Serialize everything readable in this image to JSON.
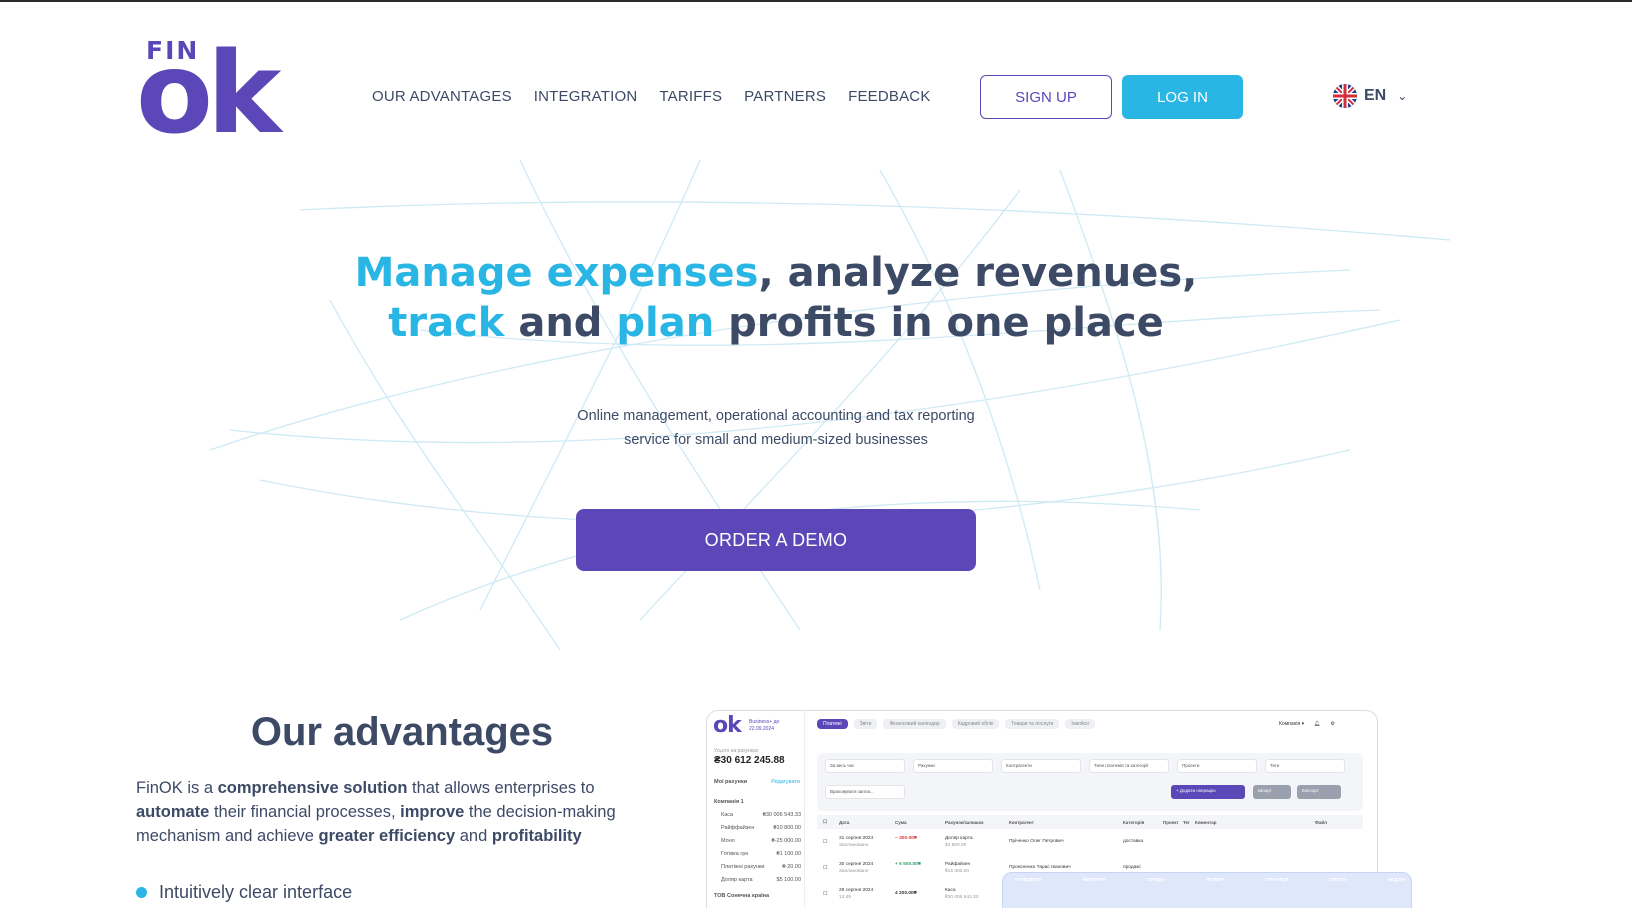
{
  "header": {
    "logo_top": "FIN",
    "logo_bottom": "ok",
    "nav": [
      "OUR ADVANTAGES",
      "INTEGRATION",
      "TARIFFS",
      "PARTNERS",
      "FEEDBACK"
    ],
    "signup_label": "SIGN UP",
    "login_label": "LOG IN",
    "language": "EN",
    "language_icon": "uk-flag-icon"
  },
  "hero": {
    "title_parts": [
      {
        "text": "Manage expenses",
        "accent": true
      },
      {
        "text": ", analyze revenues,",
        "accent": false
      },
      {
        "text": "track",
        "accent": true
      },
      {
        "text": " and ",
        "accent": false
      },
      {
        "text": "plan",
        "accent": true
      },
      {
        "text": " profits in one place",
        "accent": false
      }
    ],
    "subtitle_line1": "Online management, operational accounting and tax reporting",
    "subtitle_line2": "service for small and medium-sized businesses",
    "cta": "ORDER A DEMO"
  },
  "advantages": {
    "title": "Our advantages",
    "description": [
      {
        "t": "FinOK is a ",
        "b": false
      },
      {
        "t": "comprehensive solution",
        "b": true
      },
      {
        "t": " that allows enterprises to ",
        "b": false
      },
      {
        "t": "automate",
        "b": true
      },
      {
        "t": " their financial processes, ",
        "b": false
      },
      {
        "t": "improve",
        "b": true
      },
      {
        "t": " the decision-making mechanism and achieve ",
        "b": false
      },
      {
        "t": "greater efficiency",
        "b": true
      },
      {
        "t": " and ",
        "b": false
      },
      {
        "t": "profitability",
        "b": true
      }
    ],
    "bullet1": "Intuitively clear interface"
  },
  "app_preview": {
    "logo": "ok",
    "logo_sub": "Business+ до 22.09.2024",
    "balance_label": "Усього на рахунках",
    "balance": "₴30 612 245.88",
    "accounts_title": "Мої рахунки",
    "accounts_link": "Редагувати",
    "company": "Компанія 1",
    "accounts": [
      {
        "name": "Каса",
        "value": "₴30 006 543.33"
      },
      {
        "name": "Райффайзен",
        "value": "₴10 800.00"
      },
      {
        "name": "Моно",
        "value": "₴-25 000.00"
      },
      {
        "name": "Готівка грн",
        "value": "₴1 100.00"
      },
      {
        "name": "Платіжні рахунки",
        "value": "₴-20.00"
      },
      {
        "name": "Доляр карта",
        "value": "$5 100.00"
      }
    ],
    "company2": "ТОВ Сонячна країна",
    "tabs": [
      "Платежі",
      "Звіти",
      "Фінансовий календар",
      "Кадровий облік",
      "Товари та послуги",
      "Інвойси"
    ],
    "top_right": "Компанія ▾",
    "filters": [
      "За весь час",
      "Рахунки",
      "Контрагенти",
      "Типи платежів та категорії",
      "Проекти",
      "Теги",
      "Враховувати запла..."
    ],
    "add_btn": "+ Додати операцію",
    "import_btn": "Імпорт",
    "export_btn": "Експорт",
    "columns": [
      "Дата",
      "Сума",
      "Рахунок/залишок",
      "Контрагент",
      "Категорія",
      "Проект",
      "Тег",
      "Коментар",
      "Файл"
    ],
    "rows": [
      {
        "date": "31 серпня 2024",
        "status": "Заплановано",
        "sum": "− 300.00₴",
        "account": "Доляр карта",
        "acc_sub": "$4 800.00",
        "party": "Пріченко Олег Петрович",
        "cat": "доставка"
      },
      {
        "date": "30 серпня 2024",
        "status": "Заплановано",
        "sum": "+ 5 500.00₴",
        "account": "Райфайзен",
        "acc_sub": "₴15 300.00",
        "party": "Прокопенко Тарас Іванович",
        "cat": "продажі"
      },
      {
        "date": "29 серпня 2024",
        "status": "12:48",
        "sum": "4 200.00₴",
        "account": "Каса",
        "acc_sub": "₴30 006 543.33",
        "party": "",
        "cat": ""
      }
    ],
    "calendar_days": [
      "ПОНЕДІЛОК",
      "ВІВТОРОК",
      "СЕРЕДА",
      "ЧЕТВЕР",
      "П'ЯТНИЦЯ",
      "СУБОТА",
      "НЕДІЛЯ"
    ]
  },
  "colors": {
    "brand_purple": "#5b47b8",
    "accent_cyan": "#29b6e4",
    "text": "#3d4a66"
  }
}
